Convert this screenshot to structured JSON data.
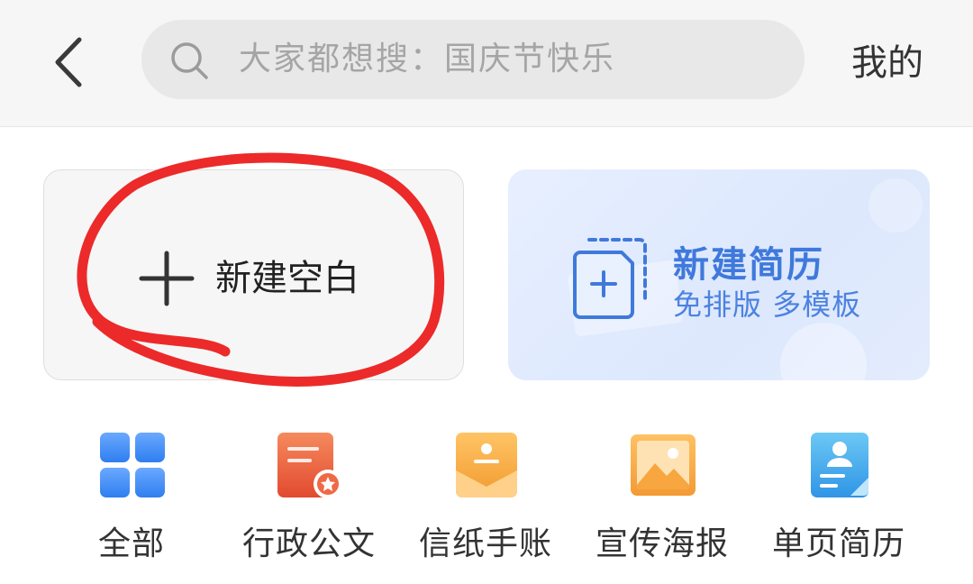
{
  "header": {
    "search_placeholder": "大家都想搜：国庆节快乐",
    "mine_label": "我的"
  },
  "cards": {
    "blank": {
      "label": "新建空白"
    },
    "resume": {
      "title": "新建简历",
      "subtitle": "免排版 多模板"
    }
  },
  "categories": [
    {
      "label": "全部",
      "icon": "grid-icon"
    },
    {
      "label": "行政公文",
      "icon": "official-document-icon"
    },
    {
      "label": "信纸手账",
      "icon": "letter-paper-icon"
    },
    {
      "label": "宣传海报",
      "icon": "poster-image-icon"
    },
    {
      "label": "单页简历",
      "icon": "resume-page-icon"
    }
  ],
  "colors": {
    "accent_blue": "#3f79dc",
    "annotation_red": "#ec2a2a",
    "icon_orange": "#f2a43a",
    "icon_red": "#e8613f"
  }
}
